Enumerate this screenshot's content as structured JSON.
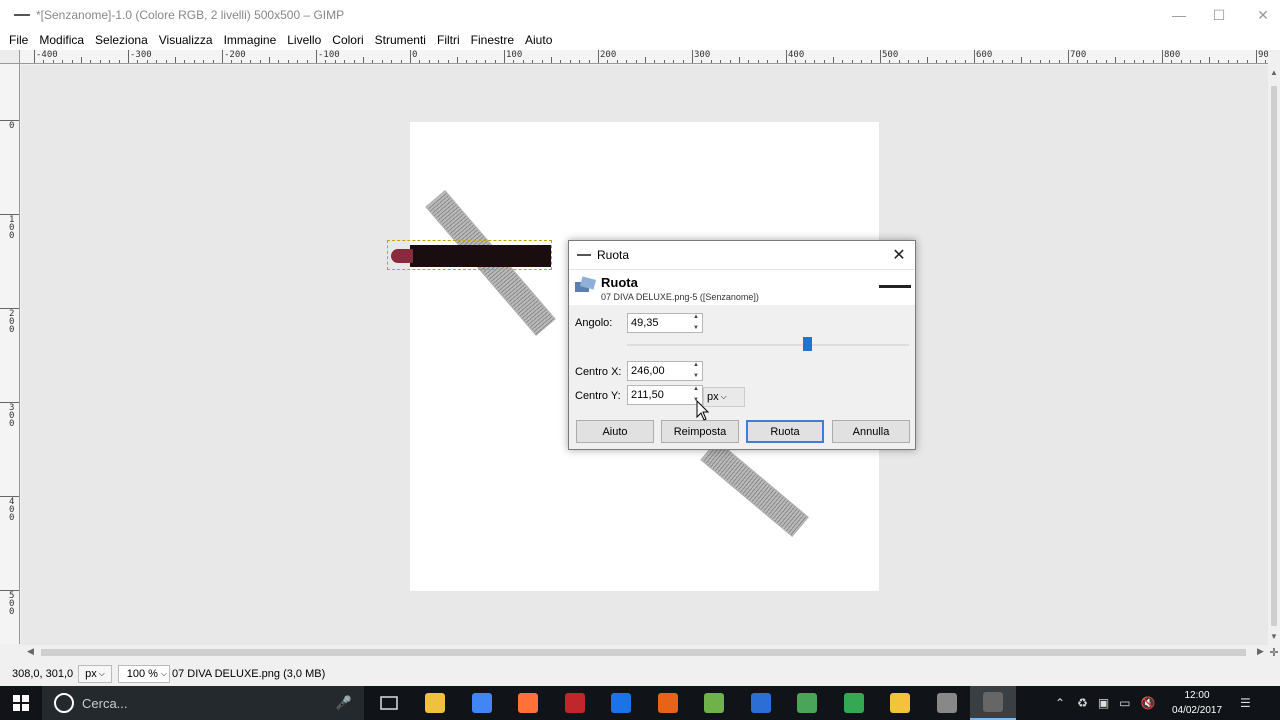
{
  "window": {
    "title": "*[Senzanome]-1.0 (Colore RGB, 2 livelli) 500x500 – GIMP"
  },
  "menu": [
    "File",
    "Modifica",
    "Seleziona",
    "Visualizza",
    "Immagine",
    "Livello",
    "Colori",
    "Strumenti",
    "Filtri",
    "Finestre",
    "Aiuto"
  ],
  "ruler_top_labels": [
    "-400",
    "-300",
    "-200",
    "-100",
    "0",
    "100",
    "200",
    "300",
    "400",
    "500",
    "600",
    "700",
    "800",
    "900"
  ],
  "ruler_left_labels": [
    "0",
    "100",
    "200",
    "300",
    "400",
    "500"
  ],
  "dialog": {
    "title": "Ruota",
    "header_title": "Ruota",
    "header_subtitle": "07 DIVA DELUXE.png-5 ([Senzanome])",
    "angle_label": "Angolo:",
    "angle_value": "49,35",
    "angle_fraction": 0.637,
    "center_x_label": "Centro X:",
    "center_x_value": "246,00",
    "center_y_label": "Centro Y:",
    "center_y_value": "211,50",
    "unit": "px",
    "buttons": {
      "help": "Aiuto",
      "reset": "Reimposta",
      "rotate": "Ruota",
      "cancel": "Annulla"
    }
  },
  "status": {
    "coords": "308,0, 301,0",
    "unit": "px",
    "zoom": "100 %",
    "file_info": "07 DIVA DELUXE.png (3,0 MB)"
  },
  "taskbar": {
    "search_placeholder": "Cerca...",
    "time": "12:00",
    "date": "04/02/2017",
    "apps": [
      "file-explorer-icon",
      "chrome-icon",
      "firefox-icon",
      "filezilla-icon",
      "pen-icon",
      "fire-icon",
      "notepad-icon",
      "photoshop-icon",
      "dreamweaver-icon",
      "recycle-icon",
      "folder-icon",
      "cat-icon",
      "gimp-icon"
    ]
  },
  "colors": {
    "accent": "#3c7fd7",
    "taskbar": "#101418"
  }
}
